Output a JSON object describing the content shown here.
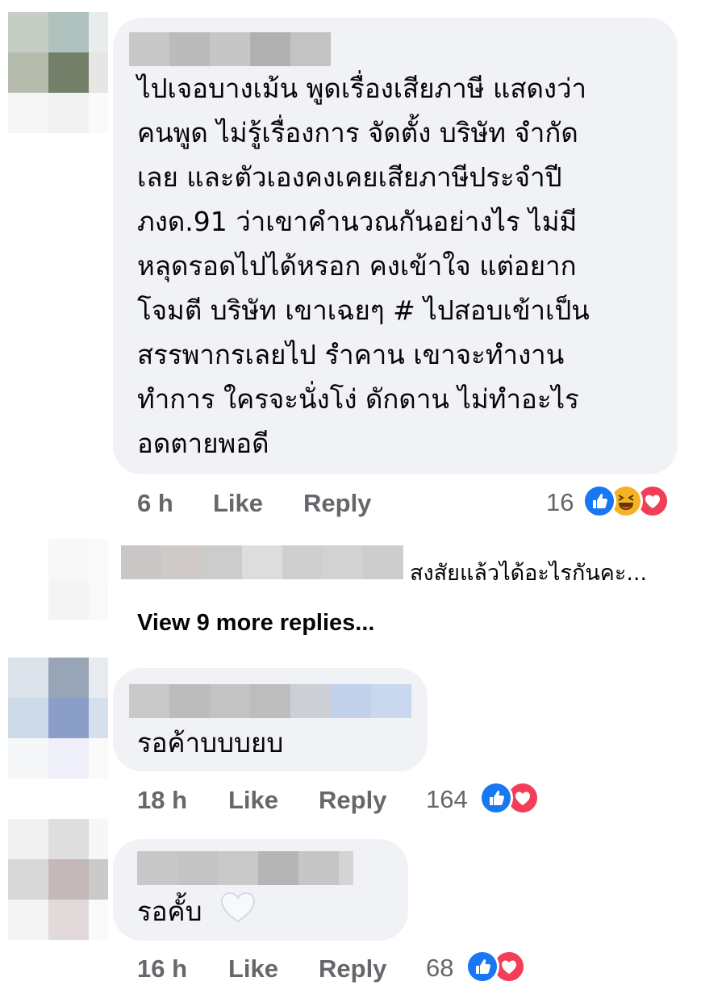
{
  "comments": [
    {
      "author": "",
      "lines": [
        "ไปเจอบางเม้น พูดเรื่องเสียภาษี แสดงว่า",
        "คนพูด ไม่รู้เรื่องการ  จัดตั้ง บริษัท จำกัด",
        "เลย  และตัวเองคงเคยเสียภาษีประจำปี",
        "ภงด.91 ว่าเขาคำนวณกันอย่างไร ไม่มี",
        "หลุดรอดไปได้หรอก คงเข้าใจ แต่อยาก",
        "โจมตี บริษัท เขาเฉยๆ # ไปสอบเข้าเป็น",
        "สรรพากรเลยไป รำคาน เขาจะทำงาน",
        "ทำการ ใครจะนั่งโง่ ดักดาน ไม่ทำอะไร",
        "อดตายพอดี"
      ],
      "time": "6 h",
      "like_label": "Like",
      "reply_label": "Reply",
      "reaction_count": "16",
      "reactions": [
        "like-icon",
        "haha-icon",
        "love-icon"
      ]
    },
    {
      "author": "",
      "text": "รอค้าบบบยบ",
      "time": "18 h",
      "like_label": "Like",
      "reply_label": "Reply",
      "reaction_count": "164",
      "reactions": [
        "like-icon",
        "love-icon"
      ]
    },
    {
      "author": "",
      "text": "รอคั้บ",
      "time": "16 h",
      "like_label": "Like",
      "reply_label": "Reply",
      "reaction_count": "68",
      "reactions": [
        "like-icon",
        "love-icon"
      ],
      "emoji": "white-heart-icon"
    }
  ],
  "reply_preview": {
    "text": "สงสัยแล้วได้อะไรกันคะ...",
    "view_more": "View 9 more replies..."
  },
  "colors": {
    "bubble": "#f0f2f5",
    "meta": "#65676b",
    "like": "#1877f2",
    "love": "#f33e58",
    "haha": "#f7b125"
  }
}
